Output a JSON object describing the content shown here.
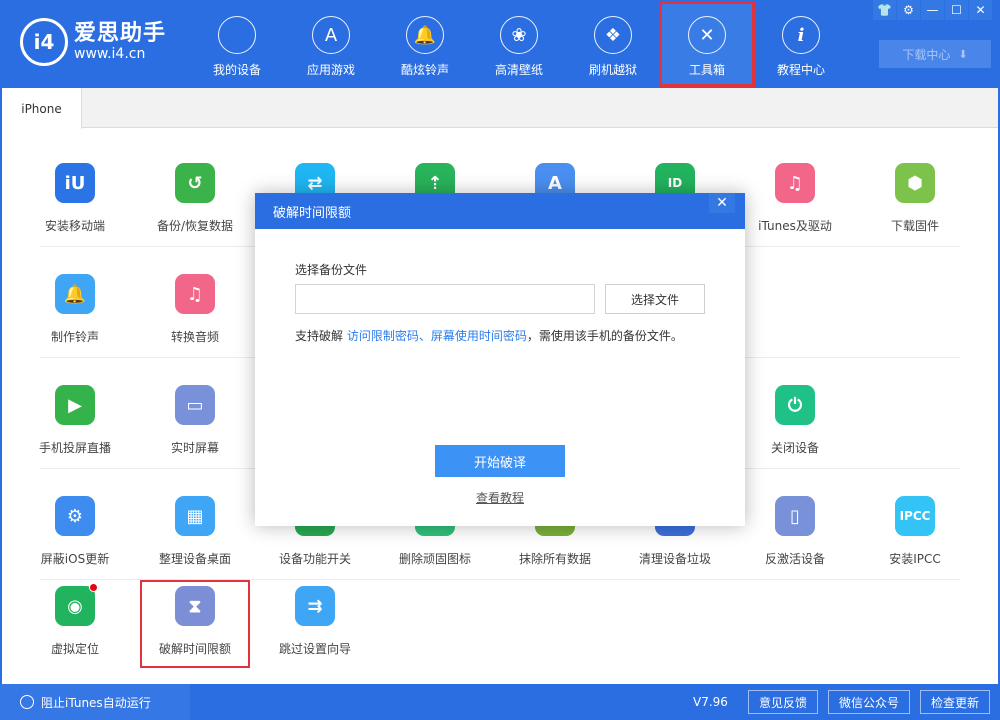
{
  "app": {
    "title": "爱思助手",
    "url": "www.i4.cn",
    "logo_glyph": "i4",
    "accent": "#2a6ee1"
  },
  "nav": [
    {
      "label": "我的设备",
      "icon": "apple-icon",
      "glyph": ""
    },
    {
      "label": "应用游戏",
      "icon": "app-store-icon",
      "glyph": "A"
    },
    {
      "label": "酷炫铃声",
      "icon": "bell-icon",
      "glyph": "🔔"
    },
    {
      "label": "高清壁纸",
      "icon": "flower-icon",
      "glyph": "❀"
    },
    {
      "label": "刷机越狱",
      "icon": "dropbox-icon",
      "glyph": "❖"
    },
    {
      "label": "工具箱",
      "icon": "tools-icon",
      "glyph": "✕",
      "active": true
    },
    {
      "label": "教程中心",
      "icon": "info-icon",
      "glyph": "i"
    }
  ],
  "window_controls": [
    {
      "name": "skin-icon",
      "glyph": "👕"
    },
    {
      "name": "settings-icon",
      "glyph": "⚙"
    },
    {
      "name": "minimize-icon",
      "glyph": "—"
    },
    {
      "name": "maximize-icon",
      "glyph": "☐"
    },
    {
      "name": "close-icon",
      "glyph": "✕"
    }
  ],
  "download_center": {
    "label": "下载中心",
    "glyph": "⬇"
  },
  "tabs": [
    {
      "label": "iPhone"
    }
  ],
  "tools": [
    [
      {
        "label": "安装移动端",
        "color": "#2a74e6",
        "glyph": "iU",
        "icon": "i4-app-icon"
      },
      {
        "label": "备份/恢复数据",
        "color": "#3cb34a",
        "glyph": "↺",
        "icon": "backup-icon"
      },
      {
        "label": "",
        "color": "#1fb6f3",
        "glyph": "⇄",
        "icon": "transfer-icon"
      },
      {
        "label": "",
        "color": "#29b35b",
        "glyph": "⇡",
        "icon": "usb-icon"
      },
      {
        "label": "",
        "color": "#4a8ff0",
        "glyph": "A",
        "icon": "app-store-icon"
      },
      {
        "label": "",
        "color": "#22b35e",
        "glyph": "ID",
        "icon": "apple-id-icon"
      },
      {
        "label": "iTunes及驱动",
        "color": "#f2668a",
        "glyph": "♫",
        "icon": "itunes-icon"
      },
      {
        "label": "下载固件",
        "color": "#7dc24a",
        "glyph": "⬢",
        "icon": "firmware-icon"
      }
    ],
    [
      {
        "label": "制作铃声",
        "color": "#3fa5f5",
        "glyph": "🔔",
        "icon": "bell-plus-icon"
      },
      {
        "label": "转换音频",
        "color": "#f2668a",
        "glyph": "♫",
        "icon": "audio-convert-icon"
      }
    ],
    [
      {
        "label": "手机投屏直播",
        "color": "#33b34a",
        "glyph": "▶",
        "icon": "screen-cast-icon"
      },
      {
        "label": "实时屏幕",
        "color": "#7891d8",
        "glyph": "▭",
        "icon": "monitor-icon"
      },
      {
        "label": "关闭设备",
        "color": "#1fc187",
        "glyph": "⏻",
        "icon": "power-icon",
        "col": 6
      }
    ],
    [
      {
        "label": "屏蔽iOS更新",
        "color": "#3e8cf0",
        "glyph": "⚙",
        "icon": "block-update-icon"
      },
      {
        "label": "整理设备桌面",
        "color": "#3fa5f5",
        "glyph": "▦",
        "icon": "desktop-grid-icon"
      },
      {
        "label": "设备功能开关",
        "color": "#27a852",
        "glyph": "",
        "icon": "toggle-icon"
      },
      {
        "label": "删除顽固图标",
        "color": "#2fc07a",
        "glyph": "",
        "icon": "delete-icon-icon"
      },
      {
        "label": "抹除所有数据",
        "color": "#7aae3a",
        "glyph": "",
        "icon": "erase-icon"
      },
      {
        "label": "清理设备垃圾",
        "color": "#3a6fdc",
        "glyph": "",
        "icon": "clean-icon"
      },
      {
        "label": "反激活设备",
        "color": "#7891d8",
        "glyph": "▯",
        "icon": "deactivate-icon"
      },
      {
        "label": "安装IPCC",
        "color": "#33c3f5",
        "glyph": "IPCC",
        "icon": "ipcc-icon"
      }
    ],
    [
      {
        "label": "虚拟定位",
        "color": "#22b35e",
        "glyph": "◉",
        "icon": "location-pin-icon",
        "badge": true
      },
      {
        "label": "破解时间限额",
        "color": "#7b8ed6",
        "glyph": "⧗",
        "icon": "hourglass-icon",
        "highlight": true
      },
      {
        "label": "跳过设置向导",
        "color": "#3fa5f5",
        "glyph": "⇉",
        "icon": "skip-setup-icon"
      }
    ]
  ],
  "dialog": {
    "title": "破解时间限额",
    "close_glyph": "✕",
    "file_label": "选择备份文件",
    "file_value": "",
    "file_placeholder": "",
    "choose_button": "选择文件",
    "hint_prefix": "支持破解 ",
    "hint_link1": "访问限制密码",
    "hint_sep": "、",
    "hint_link2": "屏幕使用时间密码",
    "hint_suffix": "，需使用该手机的备份文件。",
    "start_button": "开始破译",
    "tutorial_link": "查看教程"
  },
  "footer": {
    "itunes_toggle": "阻止iTunes自动运行",
    "version": "V7.96",
    "buttons": [
      "意见反馈",
      "微信公众号",
      "检查更新"
    ]
  }
}
